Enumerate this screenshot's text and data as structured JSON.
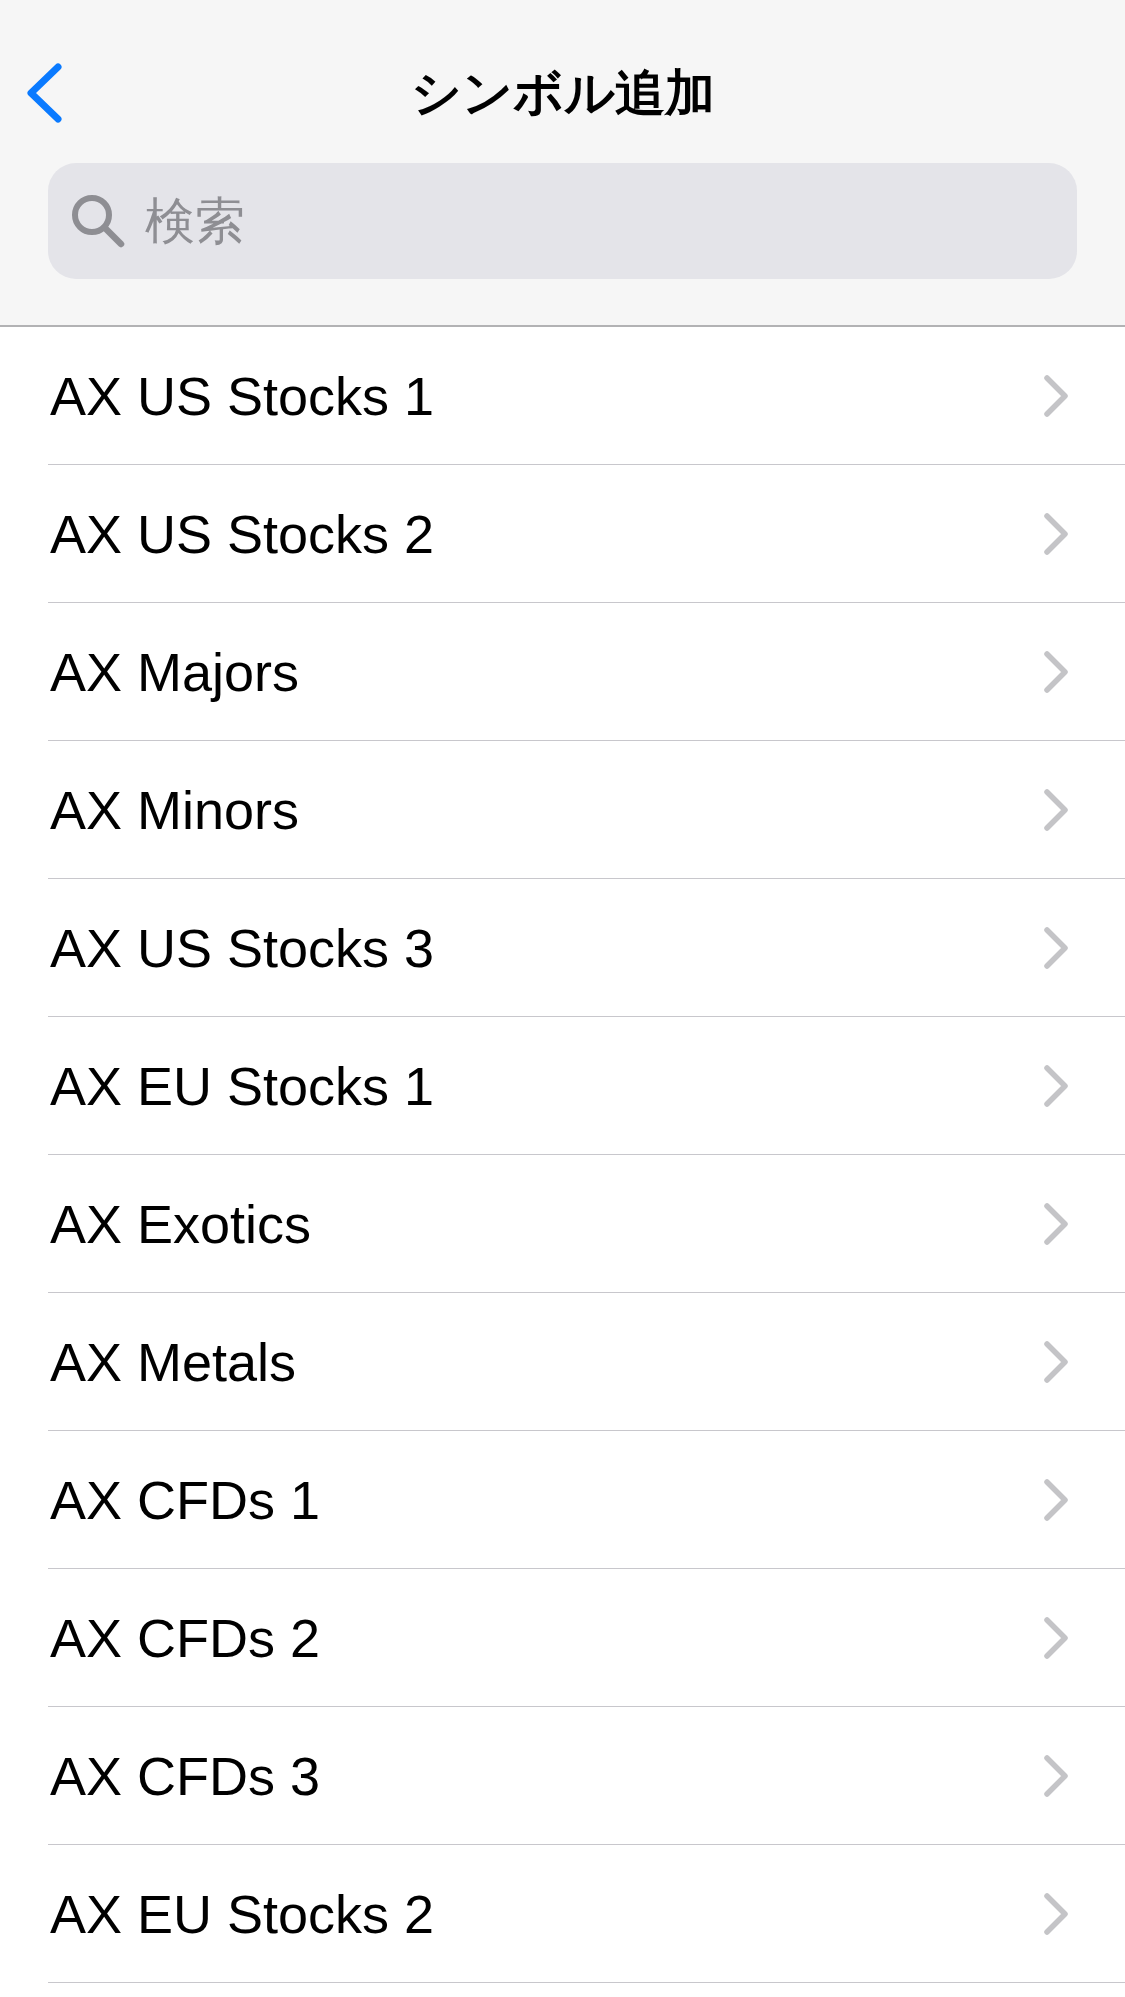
{
  "navigation_bar": {
    "title": "シンボル追加"
  },
  "search": {
    "placeholder": "検索"
  },
  "symbol_groups": [
    {
      "name": "AX US Stocks 1"
    },
    {
      "name": "AX US Stocks 2"
    },
    {
      "name": "AX Majors"
    },
    {
      "name": "AX Minors"
    },
    {
      "name": "AX US Stocks 3"
    },
    {
      "name": "AX EU Stocks 1"
    },
    {
      "name": "AX Exotics"
    },
    {
      "name": "AX Metals"
    },
    {
      "name": "AX CFDs 1"
    },
    {
      "name": "AX CFDs 2"
    },
    {
      "name": "AX CFDs 3"
    },
    {
      "name": "AX EU Stocks 2"
    }
  ]
}
